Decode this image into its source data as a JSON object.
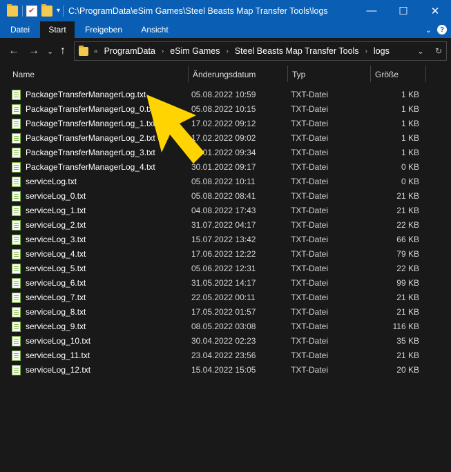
{
  "window": {
    "title": "C:\\ProgramData\\eSim Games\\Steel Beasts Map Transfer Tools\\logs",
    "controls": {
      "minimize": "—",
      "maximize": "☐",
      "close": "✕"
    }
  },
  "ribbon": {
    "tabs": [
      "Datei",
      "Start",
      "Freigeben",
      "Ansicht"
    ],
    "active_tab": "Start",
    "expand_glyph": "⌄",
    "help_glyph": "?"
  },
  "nav": {
    "back": "←",
    "forward": "→",
    "recent": "⌄",
    "up": "↑"
  },
  "address": {
    "overflow": "«",
    "crumbs": [
      "ProgramData",
      "eSim Games",
      "Steel Beasts Map Transfer Tools",
      "logs"
    ],
    "separator": "›",
    "dropdown": "⌄",
    "refresh": "↻"
  },
  "columns": {
    "name": "Name",
    "date": "Änderungsdatum",
    "type": "Typ",
    "size": "Größe"
  },
  "files": [
    {
      "name": "PackageTransferManagerLog.txt",
      "date": "05.08.2022 10:59",
      "type": "TXT-Datei",
      "size": "1 KB"
    },
    {
      "name": "PackageTransferManagerLog_0.txt",
      "date": "05.08.2022 10:15",
      "type": "TXT-Datei",
      "size": "1 KB"
    },
    {
      "name": "PackageTransferManagerLog_1.txt",
      "date": "17.02.2022 09:12",
      "type": "TXT-Datei",
      "size": "1 KB"
    },
    {
      "name": "PackageTransferManagerLog_2.txt",
      "date": "17.02.2022 09:02",
      "type": "TXT-Datei",
      "size": "1 KB"
    },
    {
      "name": "PackageTransferManagerLog_3.txt",
      "date": "30.01.2022 09:34",
      "type": "TXT-Datei",
      "size": "1 KB"
    },
    {
      "name": "PackageTransferManagerLog_4.txt",
      "date": "30.01.2022 09:17",
      "type": "TXT-Datei",
      "size": "0 KB"
    },
    {
      "name": "serviceLog.txt",
      "date": "05.08.2022 10:11",
      "type": "TXT-Datei",
      "size": "0 KB"
    },
    {
      "name": "serviceLog_0.txt",
      "date": "05.08.2022 08:41",
      "type": "TXT-Datei",
      "size": "21 KB"
    },
    {
      "name": "serviceLog_1.txt",
      "date": "04.08.2022 17:43",
      "type": "TXT-Datei",
      "size": "21 KB"
    },
    {
      "name": "serviceLog_2.txt",
      "date": "31.07.2022 04:17",
      "type": "TXT-Datei",
      "size": "22 KB"
    },
    {
      "name": "serviceLog_3.txt",
      "date": "15.07.2022 13:42",
      "type": "TXT-Datei",
      "size": "66 KB"
    },
    {
      "name": "serviceLog_4.txt",
      "date": "17.06.2022 12:22",
      "type": "TXT-Datei",
      "size": "79 KB"
    },
    {
      "name": "serviceLog_5.txt",
      "date": "05.06.2022 12:31",
      "type": "TXT-Datei",
      "size": "22 KB"
    },
    {
      "name": "serviceLog_6.txt",
      "date": "31.05.2022 14:17",
      "type": "TXT-Datei",
      "size": "99 KB"
    },
    {
      "name": "serviceLog_7.txt",
      "date": "22.05.2022 00:11",
      "type": "TXT-Datei",
      "size": "21 KB"
    },
    {
      "name": "serviceLog_8.txt",
      "date": "17.05.2022 01:57",
      "type": "TXT-Datei",
      "size": "21 KB"
    },
    {
      "name": "serviceLog_9.txt",
      "date": "08.05.2022 03:08",
      "type": "TXT-Datei",
      "size": "116 KB"
    },
    {
      "name": "serviceLog_10.txt",
      "date": "30.04.2022 02:23",
      "type": "TXT-Datei",
      "size": "35 KB"
    },
    {
      "name": "serviceLog_11.txt",
      "date": "23.04.2022 23:56",
      "type": "TXT-Datei",
      "size": "21 KB"
    },
    {
      "name": "serviceLog_12.txt",
      "date": "15.04.2022 15:05",
      "type": "TXT-Datei",
      "size": "20 KB"
    }
  ],
  "colors": {
    "titlebar": "#0a5fb4",
    "background": "#191919",
    "annotation_arrow": "#ffd400"
  }
}
